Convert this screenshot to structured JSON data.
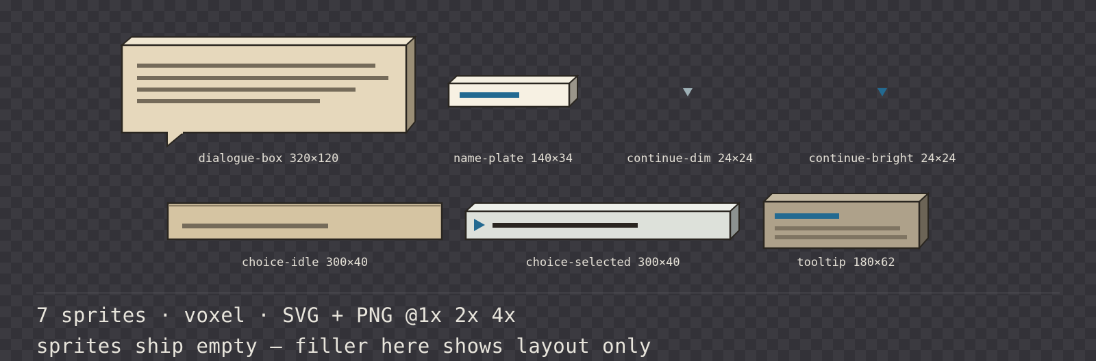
{
  "sprites": [
    {
      "name": "dialogue-box",
      "size": "320×120",
      "label": "dialogue-box 320×120"
    },
    {
      "name": "name-plate",
      "size": "140×34",
      "label": "name-plate 140×34"
    },
    {
      "name": "continue-dim",
      "size": "24×24",
      "label": "continue-dim 24×24"
    },
    {
      "name": "continue-bright",
      "size": "24×24",
      "label": "continue-bright 24×24"
    },
    {
      "name": "choice-idle",
      "size": "300×40",
      "label": "choice-idle 300×40"
    },
    {
      "name": "choice-selected",
      "size": "300×40",
      "label": "choice-selected 300×40"
    },
    {
      "name": "tooltip",
      "size": "180×62",
      "label": "tooltip 180×62"
    }
  ],
  "footer": {
    "line1": "7 sprites · voxel · SVG + PNG @1x 2x 4x",
    "line2": "sprites ship empty — filler here shows layout only"
  },
  "colors": {
    "background": "#3b3a40",
    "checker": "#333238",
    "parchment": "#e6d8bc",
    "outline": "#2a2620",
    "accent_blue": "#236a91",
    "filler_text": "#756b5a",
    "caption_text": "#e4e0d6"
  }
}
